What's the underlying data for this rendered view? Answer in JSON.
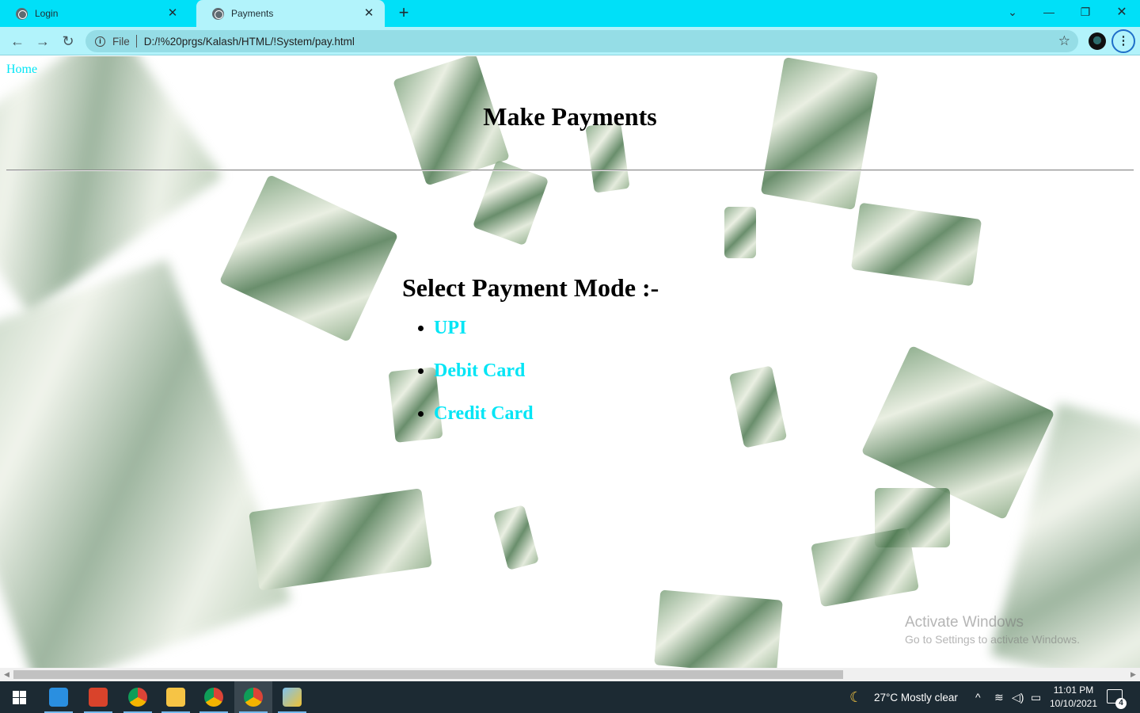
{
  "browser": {
    "tabs": [
      {
        "title": "Login",
        "active": false
      },
      {
        "title": "Payments",
        "active": true
      }
    ],
    "new_tab_symbol": "+",
    "address": {
      "scheme_label": "File",
      "url": "D:/!%20prgs/Kalash/HTML/!System/pay.html"
    },
    "accent_color": "#00e0f8"
  },
  "page": {
    "home_link": "Home",
    "title": "Make Payments",
    "section_title": "Select Payment Mode :-",
    "payment_modes": [
      "UPI",
      "Debit Card",
      "Credit Card"
    ],
    "link_color": "#00e5f5"
  },
  "watermark": {
    "title": "Activate Windows",
    "subtitle": "Go to Settings to activate Windows."
  },
  "taskbar": {
    "weather": "27°C  Mostly clear",
    "time": "11:01 PM",
    "date": "10/10/2021",
    "notification_count": "4"
  }
}
